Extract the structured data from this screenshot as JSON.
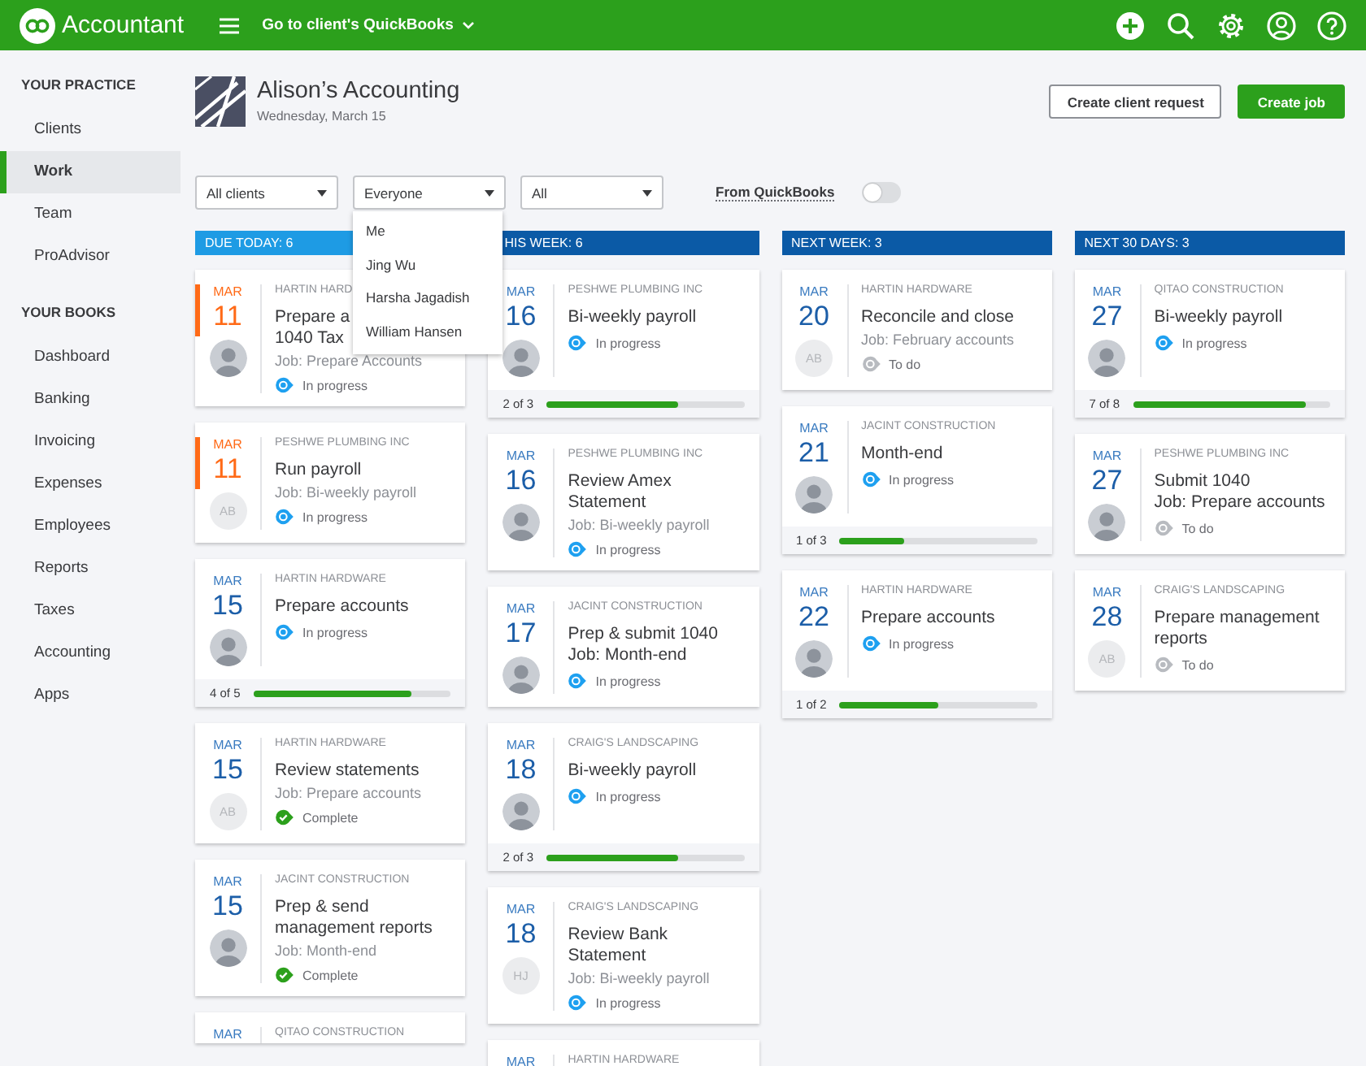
{
  "topbar": {
    "product": "Accountant",
    "client_switch": "Go to client's QuickBooks"
  },
  "sidebar": {
    "sections": [
      {
        "heading": "YOUR PRACTICE",
        "items": [
          {
            "label": "Clients",
            "selected": false
          },
          {
            "label": "Work",
            "selected": true
          },
          {
            "label": "Team",
            "selected": false
          },
          {
            "label": "ProAdvisor",
            "selected": false
          }
        ]
      },
      {
        "heading": "YOUR BOOKS",
        "items": [
          {
            "label": "Dashboard",
            "selected": false
          },
          {
            "label": "Banking",
            "selected": false
          },
          {
            "label": "Invoicing",
            "selected": false
          },
          {
            "label": "Expenses",
            "selected": false
          },
          {
            "label": "Employees",
            "selected": false
          },
          {
            "label": "Reports",
            "selected": false
          },
          {
            "label": "Taxes",
            "selected": false
          },
          {
            "label": "Accounting",
            "selected": false
          },
          {
            "label": "Apps",
            "selected": false
          }
        ]
      }
    ]
  },
  "header": {
    "company": "Alison’s Accounting",
    "date": "Wednesday, March 15",
    "buttons": [
      {
        "label": "Create client request",
        "kind": "secondary"
      },
      {
        "label": "Create job",
        "kind": "primary"
      }
    ]
  },
  "filters": [
    {
      "value": "All clients"
    },
    {
      "value": "Everyone",
      "menu": [
        "Me",
        "Jing Wu",
        "Harsha Jagadish",
        "William Hansen"
      ]
    },
    {
      "value": "All"
    }
  ],
  "toggle": {
    "label": "From QuickBooks",
    "on": false
  },
  "columns": [
    {
      "title": "DUE TODAY: 6",
      "color": "#1e9be4",
      "cards": [
        {
          "month": "MAR",
          "day": "11",
          "overdue": true,
          "client": "HARTIN HARD",
          "title": "Prepare a\n1040 Tax",
          "job": {
            "text": "Job: Prepare Accounts",
            "kind": "muted"
          },
          "status": {
            "kind": "in_progress",
            "label": "In progress"
          },
          "avatar": {
            "kind": "photo"
          }
        },
        {
          "month": "MAR",
          "day": "11",
          "overdue": true,
          "client": "PESHWE PLUMBING INC",
          "title": "Run payroll",
          "job": {
            "text": "Job: Bi-weekly payroll",
            "kind": "muted"
          },
          "status": {
            "kind": "in_progress",
            "label": "In progress"
          },
          "avatar": {
            "kind": "initials",
            "text": "AB"
          }
        },
        {
          "month": "MAR",
          "day": "15",
          "overdue": false,
          "client": "HARTIN HARDWARE",
          "title": "Prepare accounts",
          "status": {
            "kind": "in_progress",
            "label": "In progress"
          },
          "avatar": {
            "kind": "photo"
          },
          "progress": {
            "text": "4 of 5",
            "level": 0.8
          }
        },
        {
          "month": "MAR",
          "day": "15",
          "overdue": false,
          "client": "HARTIN HARDWARE",
          "title": "Review statements",
          "job": {
            "text": "Job: Prepare accounts",
            "kind": "muted"
          },
          "status": {
            "kind": "complete",
            "label": "Complete"
          },
          "avatar": {
            "kind": "initials",
            "text": "AB"
          }
        },
        {
          "month": "MAR",
          "day": "15",
          "overdue": false,
          "client": "JACINT CONSTRUCTION",
          "title": "Prep & send\nmanagement reports",
          "job": {
            "text": "Job: Month-end",
            "kind": "muted"
          },
          "status": {
            "kind": "complete",
            "label": "Complete"
          },
          "avatar": {
            "kind": "photo"
          }
        },
        {
          "month": "MAR",
          "overdue": false,
          "client": "QITAO CONSTRUCTION"
        }
      ]
    },
    {
      "title": "HIS WEEK: 6",
      "color": "#0b5aa6",
      "cards": [
        {
          "month": "MAR",
          "day": "16",
          "overdue": false,
          "client": "PESHWE PLUMBING INC",
          "title": "Bi-weekly payroll",
          "status": {
            "kind": "in_progress",
            "label": "In progress"
          },
          "avatar": {
            "kind": "photo"
          },
          "progress": {
            "text": "2 of 3",
            "level": 0.67
          }
        },
        {
          "month": "MAR",
          "day": "16",
          "overdue": false,
          "client": "PESHWE PLUMBING INC",
          "title": "Review Amex\nStatement",
          "job": {
            "text": "Job: Bi-weekly payroll",
            "kind": "muted"
          },
          "status": {
            "kind": "in_progress",
            "label": "In progress"
          },
          "avatar": {
            "kind": "photo"
          }
        },
        {
          "month": "MAR",
          "day": "17",
          "overdue": false,
          "client": "JACINT CONSTRUCTION",
          "title": "Prep & submit 1040",
          "job": {
            "text": "Job: Month-end",
            "kind": "emphasis"
          },
          "status": {
            "kind": "in_progress",
            "label": "In progress"
          },
          "avatar": {
            "kind": "photo"
          }
        },
        {
          "month": "MAR",
          "day": "18",
          "overdue": false,
          "client": "CRAIG'S LANDSCAPING",
          "title": "Bi-weekly payroll",
          "status": {
            "kind": "in_progress",
            "label": "In progress"
          },
          "avatar": {
            "kind": "photo"
          },
          "progress": {
            "text": "2 of 3",
            "level": 0.67
          }
        },
        {
          "month": "MAR",
          "day": "18",
          "overdue": false,
          "client": "CRAIG'S LANDSCAPING",
          "title": "Review Bank\nStatement",
          "job": {
            "text": "Job: Bi-weekly payroll",
            "kind": "muted"
          },
          "status": {
            "kind": "in_progress",
            "label": "In progress"
          },
          "avatar": {
            "kind": "initials",
            "text": "HJ"
          }
        },
        {
          "month": "MAR",
          "overdue": false,
          "client": "HARTIN HARDWARE"
        }
      ]
    },
    {
      "title": "NEXT WEEK: 3",
      "color": "#0b5aa6",
      "cards": [
        {
          "month": "MAR",
          "day": "20",
          "overdue": false,
          "client": "HARTIN HARDWARE",
          "title": "Reconcile and close",
          "job": {
            "text": "Job: February accounts",
            "kind": "muted"
          },
          "status": {
            "kind": "todo",
            "label": "To do"
          },
          "avatar": {
            "kind": "initials",
            "text": "AB"
          }
        },
        {
          "month": "MAR",
          "day": "21",
          "overdue": false,
          "client": "JACINT CONSTRUCTION",
          "title": "Month-end",
          "status": {
            "kind": "in_progress",
            "label": "In progress"
          },
          "avatar": {
            "kind": "photo"
          },
          "progress": {
            "text": "1 of 3",
            "level": 0.33
          }
        },
        {
          "month": "MAR",
          "day": "22",
          "overdue": false,
          "client": "HARTIN HARDWARE",
          "title": "Prepare accounts",
          "status": {
            "kind": "in_progress",
            "label": "In progress"
          },
          "avatar": {
            "kind": "photo"
          },
          "progress": {
            "text": "1 of 2",
            "level": 0.5
          }
        }
      ]
    },
    {
      "title": "NEXT 30 DAYS: 3",
      "color": "#0b5aa6",
      "cards": [
        {
          "month": "MAR",
          "day": "27",
          "overdue": false,
          "client": "QITAO CONSTRUCTION",
          "title": "Bi-weekly payroll",
          "status": {
            "kind": "in_progress",
            "label": "In progress"
          },
          "avatar": {
            "kind": "photo"
          },
          "progress": {
            "text": "7 of 8",
            "level": 0.875
          }
        },
        {
          "month": "MAR",
          "day": "27",
          "overdue": false,
          "client": "PESHWE PLUMBING INC",
          "title": "Submit 1040",
          "job": {
            "text": "Job: Prepare accounts",
            "kind": "emphasis"
          },
          "status": {
            "kind": "todo",
            "label": "To do"
          },
          "avatar": {
            "kind": "photo"
          }
        },
        {
          "month": "MAR",
          "day": "28",
          "overdue": false,
          "client": "CRAIG'S LANDSCAPING",
          "title": "Prepare management\nreports",
          "status": {
            "kind": "todo",
            "label": "To do"
          },
          "avatar": {
            "kind": "initials",
            "text": "AB"
          }
        }
      ]
    }
  ]
}
